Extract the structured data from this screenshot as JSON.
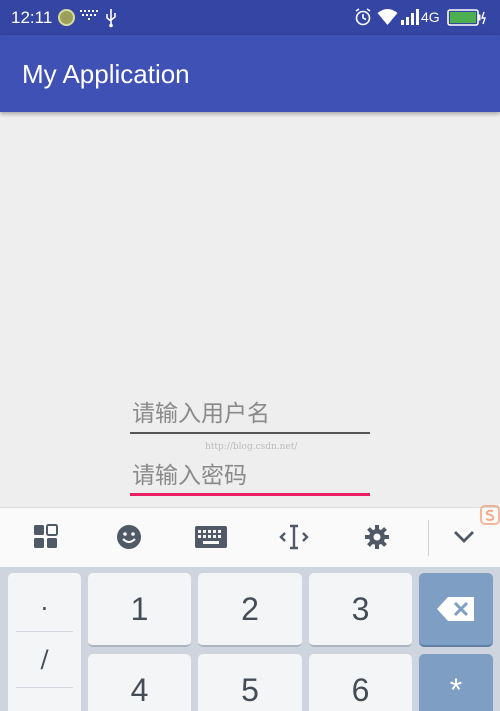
{
  "status_bar": {
    "time": "12:11",
    "network": "4G",
    "icons": [
      "notification-circle-icon",
      "dots-icon",
      "usb-icon",
      "alarm-icon",
      "wifi-icon",
      "signal-icon",
      "battery-icon"
    ]
  },
  "app_bar": {
    "title": "My Application"
  },
  "form": {
    "username_placeholder": "请输入用户名",
    "password_placeholder": "请输入密码"
  },
  "watermark": "http://blog.csdn.net/",
  "keyboard": {
    "toolbar_icons": [
      "grid-apps-icon",
      "emoji-icon",
      "keyboard-icon",
      "cursor-icon",
      "settings-icon",
      "collapse-chevron-icon"
    ],
    "side_keys": [
      "·",
      "/",
      "-"
    ],
    "digits": [
      "1",
      "2",
      "3",
      "4",
      "5",
      "6"
    ],
    "action_keys": [
      "backspace-icon",
      "*"
    ],
    "star_label": "*"
  },
  "colors": {
    "status_bar": "#3545a3",
    "app_bar": "#3f51b5",
    "accent_underline": "#e91e63",
    "keyboard_bg": "#cfd5de",
    "action_key": "#7e9ec4"
  }
}
